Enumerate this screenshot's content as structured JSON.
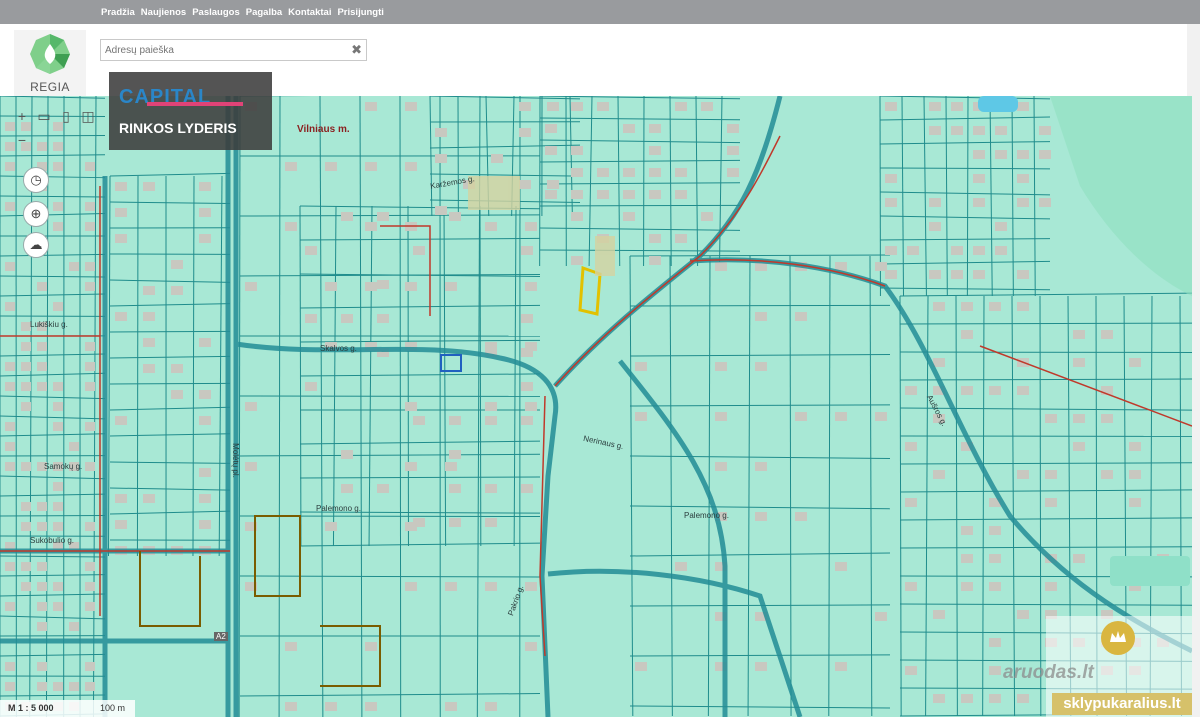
{
  "topnav": [
    "Pradžia",
    "Naujienos",
    "Paslaugos",
    "Pagalba",
    "Kontaktai",
    "Prisijungti"
  ],
  "logo_text": "REGIA",
  "search": {
    "placeholder": "Adresų paieška",
    "clear": "✖"
  },
  "banner": {
    "brand": "CAPITAL",
    "slogan": "RINKOS LYDERIS"
  },
  "map_labels": {
    "vilniaus": "Vilniaus m.",
    "skalvos": "Skalvos g.",
    "nerinaus": "Nerinaus g.",
    "palemono1": "Palemono g.",
    "palemono2": "Palemono g.",
    "molet": "Molėtų pl.",
    "samoki": "Samokų g.",
    "lukiskiu": "Lukiškiu g.",
    "sukobulis": "Sukobulio g.",
    "ausros": "Aušros g.",
    "karzemos": "Karžemos g.",
    "pakrio": "Pakrio g.",
    "a2": "A2"
  },
  "scale": {
    "ratio": "M 1 : 5 000",
    "distance": "100 m"
  },
  "watermark": {
    "site1": "aruodas.lt",
    "site2": "sklypukaralius.lt"
  },
  "colors": {
    "parcel_fill": "#a8e8d5",
    "parcel_line": "#1f8c8c",
    "building": "#c8c8c0",
    "utility": "#c0392b",
    "selected": "#e2c100"
  }
}
